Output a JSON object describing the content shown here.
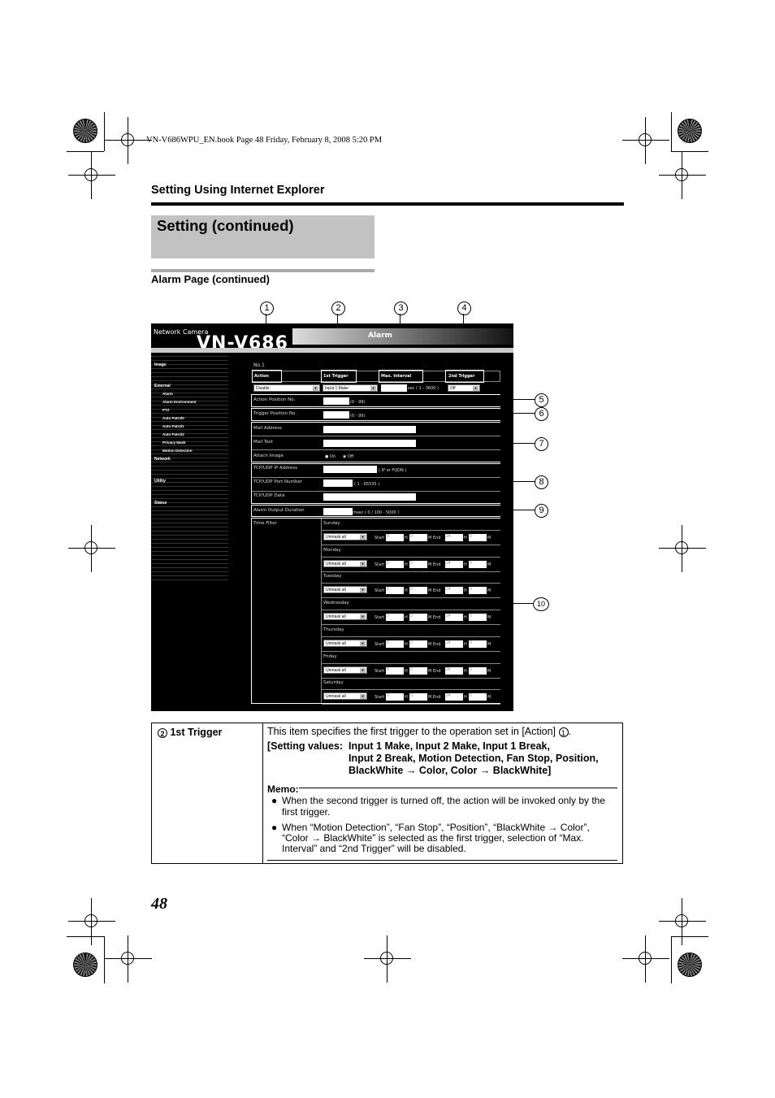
{
  "print_header": "VN-V686WPU_EN.book  Page 48  Friday, February 8, 2008  5:20 PM",
  "section_header": "Setting Using Internet Explorer",
  "title": "Setting (continued)",
  "subtitle": "Alarm Page (continued)",
  "page_number": "48",
  "callouts": [
    "1",
    "2",
    "3",
    "4",
    "5",
    "6",
    "7",
    "8",
    "9",
    "10"
  ],
  "screenshot": {
    "brand": "Network Camera",
    "model": "VN-V686",
    "page_tab": "Alarm",
    "nav": [
      "Image",
      "External",
      "Alarm",
      "Alarm Environment",
      "PTZ",
      "Auto Patrol0",
      "Auto Patrol1",
      "Auto Patrol2",
      "Privacy Mask",
      "Motion Detection",
      "Network",
      "Utility",
      "Status"
    ],
    "no_label": "No.1",
    "col_headers": [
      "Action",
      "1st Trigger",
      "Max. Interval",
      "2nd Trigger"
    ],
    "action_value": "Disable",
    "trigger_value": "Input 1 Make",
    "interval_hint": "sec ( 1 - 3600 )",
    "second_trigger_value": "Off",
    "rows": {
      "action_pos": "Action Position No.",
      "action_pos_hint": "(0 - 99)",
      "trigger_pos": "Trigger Position No.",
      "trigger_pos_hint": "(0 - 99)",
      "mail_address": "Mail Address",
      "mail_text": "Mail Text",
      "attach_image": "Attach Image",
      "attach_on": "On",
      "attach_off": "Off",
      "tcp_ip": "TCP/UDP IP Address",
      "tcp_ip_hint": "( IP or FQDN )",
      "tcp_port": "TCP/UDP Port Number",
      "tcp_port_hint": "( 1 - 65535 )",
      "tcp_data": "TCP/UDP Data",
      "alarm_out": "Alarm Output Duration",
      "alarm_out_hint": "msec ( 0 / 100 - 5000 )",
      "time_filter": "Time Filter"
    },
    "days": [
      "Sunday",
      "Monday",
      "Tuesday",
      "Wednesday",
      "Thursday",
      "Friday",
      "Saturday"
    ],
    "day_select": "Unmask all",
    "start_label": "Start",
    "h_label": "H",
    "m_end_label": "M End",
    "m_label": "M",
    "start_h": "0",
    "start_m": "0",
    "end_h": "24",
    "end_m": "0"
  },
  "table": {
    "item_num": "2",
    "item_name": "1st Trigger",
    "desc": "This item specifies the first trigger to the operation set in [Action]",
    "desc_ref": "1",
    "setting_label": "[Setting values:",
    "setting_line1": "Input 1 Make, Input 2 Make, Input 1 Break,",
    "setting_line2": "Input 2 Break, Motion Detection, Fan Stop, Position,",
    "setting_line3": "BlackWhite → Color, Color → BlackWhite]",
    "memo_label": "Memo:",
    "memo1": "When the second trigger is turned off, the action will be invoked only by the first trigger.",
    "memo2": "When “Motion Detection”, “Fan Stop”, “Position”, “BlackWhite → Color”, “Color → BlackWhite” is selected as the first trigger, selection of “Max. Interval” and “2nd Trigger” will be disabled."
  }
}
